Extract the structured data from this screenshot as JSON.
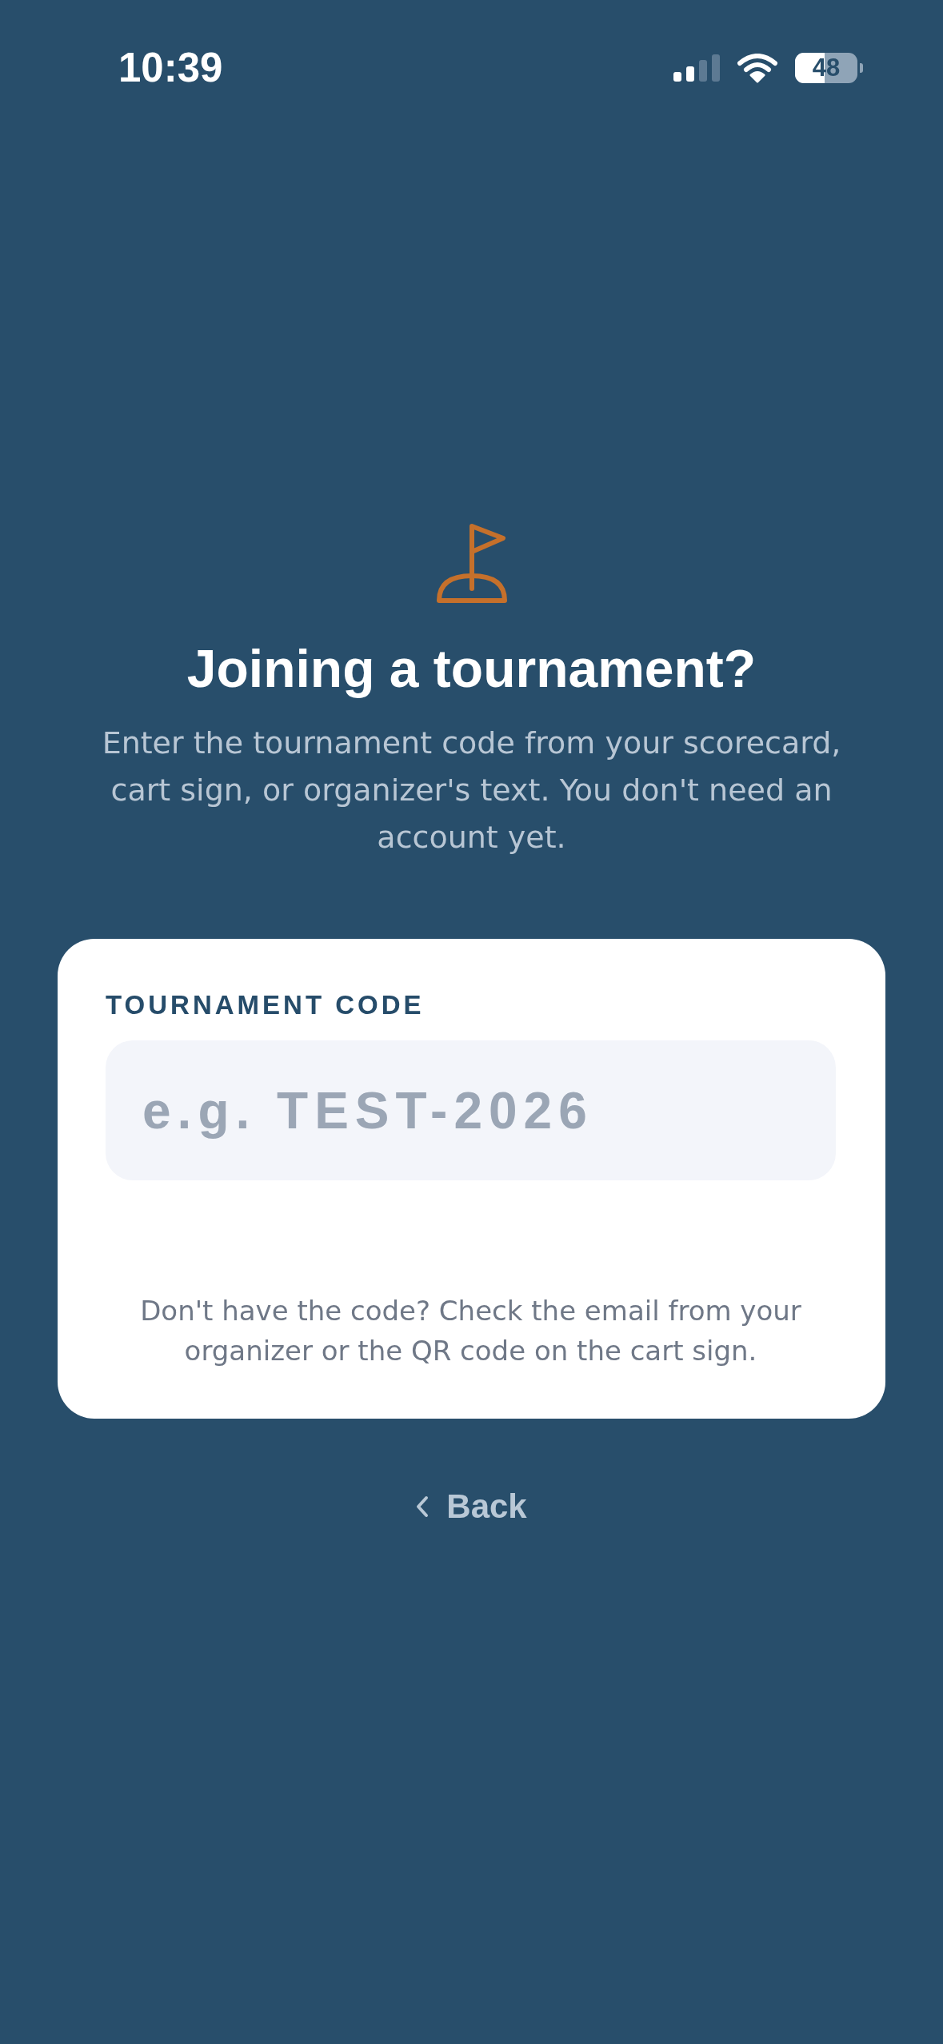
{
  "status_bar": {
    "time": "10:39",
    "battery": "48"
  },
  "header": {
    "title": "Joining a tournament?",
    "subtitle": "Enter the tournament code from your scorecard, cart sign, or organizer's text. You don't need an account yet."
  },
  "code_card": {
    "label": "TOURNAMENT CODE",
    "field": {
      "placeholder": "e.g. TEST-2026"
    },
    "help": "Don't have the code? Check the email from your organizer or the QR code on the cart sign."
  },
  "back_button": {
    "label": "Back"
  }
}
